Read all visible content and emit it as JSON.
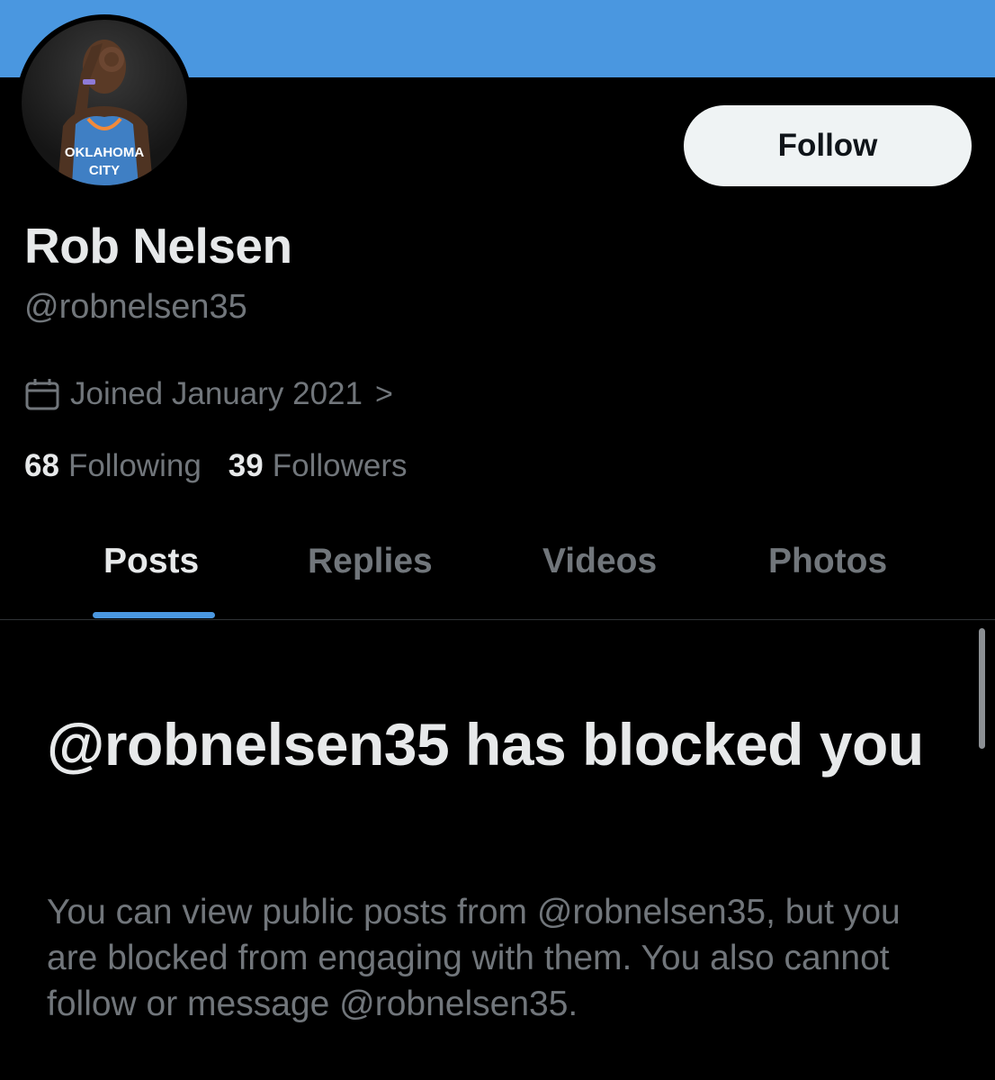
{
  "colors": {
    "banner": "#4a97e0",
    "background": "#000000",
    "primary_text": "#e7e9ea",
    "secondary_text": "#71767b",
    "accent": "#4a97e0",
    "follow_button_bg": "#eff3f4"
  },
  "profile": {
    "avatar_icon": "profile-avatar",
    "avatar_jersey_text": "OKLAHOMA CITY",
    "name": "Rob Nelsen",
    "handle": "@robnelsen35",
    "joined_icon": "calendar-icon",
    "joined_text": "Joined January 2021",
    "joined_chevron": ">"
  },
  "actions": {
    "follow_label": "Follow"
  },
  "stats": {
    "following_count": "68",
    "following_label": "Following",
    "followers_count": "39",
    "followers_label": "Followers"
  },
  "tabs": [
    {
      "label": "Posts",
      "active": true
    },
    {
      "label": "Replies",
      "active": false
    },
    {
      "label": "Videos",
      "active": false
    },
    {
      "label": "Photos",
      "active": false
    }
  ],
  "blocked": {
    "title": "@robnelsen35 has blocked you",
    "description": "You can view public posts from @robnelsen35, but you are blocked from engaging with them. You also cannot follow or message @robnelsen35."
  }
}
